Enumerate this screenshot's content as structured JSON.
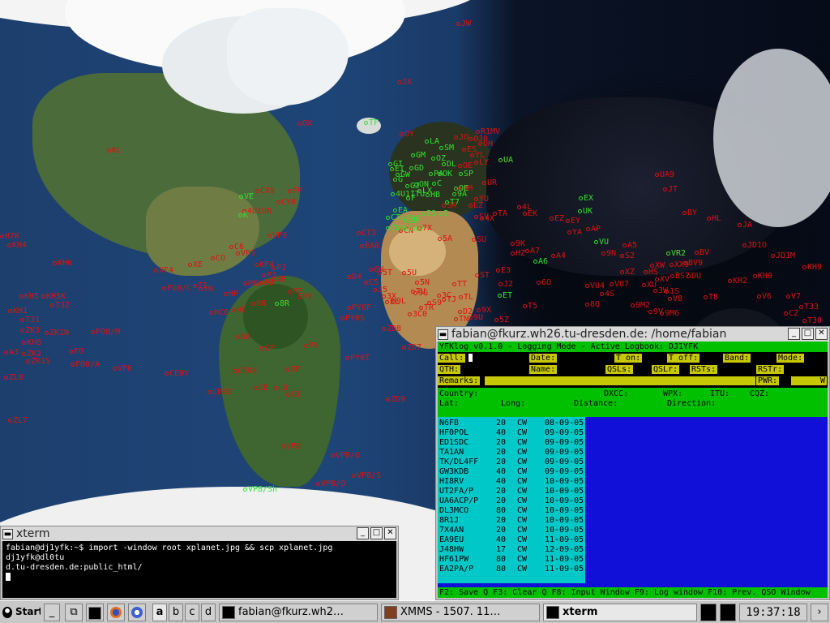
{
  "map": {
    "labels_red": [
      [
        "JW",
        563,
        30
      ],
      [
        "JX",
        490,
        102
      ],
      [
        "OX",
        367,
        153
      ],
      [
        "OY",
        493,
        166
      ],
      [
        "KL",
        132,
        186
      ],
      [
        "R1MV",
        587,
        163
      ],
      [
        "OH",
        590,
        178
      ],
      [
        "JO",
        560,
        170
      ],
      [
        "OJ0",
        578,
        172
      ],
      [
        "ES",
        570,
        185
      ],
      [
        "YL",
        580,
        192
      ],
      [
        "LY",
        585,
        201
      ],
      [
        "UR",
        595,
        226
      ],
      [
        "UA",
        615,
        198
      ],
      [
        "OE",
        565,
        205
      ],
      [
        "OM",
        565,
        233
      ],
      [
        "YU",
        585,
        246
      ],
      [
        "LZ",
        578,
        254
      ],
      [
        "SV",
        585,
        268
      ],
      [
        "TA",
        608,
        264
      ],
      [
        "4L",
        638,
        256
      ],
      [
        "EK",
        645,
        264
      ],
      [
        "EZ",
        678,
        270
      ],
      [
        "EY",
        698,
        273
      ],
      [
        "AP",
        723,
        283
      ],
      [
        "YA",
        700,
        287
      ],
      [
        "9K",
        630,
        301
      ],
      [
        "A4",
        680,
        316
      ],
      [
        "HZ",
        630,
        313
      ],
      [
        "A7",
        648,
        310
      ],
      [
        "4X",
        592,
        270
      ],
      [
        "SU",
        582,
        296
      ],
      [
        "5A",
        540,
        295
      ],
      [
        "7X",
        515,
        282
      ],
      [
        "3A",
        545,
        254
      ],
      [
        "CN",
        492,
        285
      ],
      [
        "CT3",
        440,
        288
      ],
      [
        "EA8",
        444,
        304
      ],
      [
        "CX9",
        315,
        236
      ],
      [
        "FP",
        355,
        236
      ],
      [
        "CY0",
        341,
        250
      ],
      [
        "4U1UN",
        299,
        261
      ],
      [
        "VP9",
        330,
        291
      ],
      [
        "C6",
        283,
        305
      ],
      [
        "XE",
        232,
        327
      ],
      [
        "CO",
        260,
        319
      ],
      [
        "VP5",
        291,
        313
      ],
      [
        "KP4",
        314,
        327
      ],
      [
        "FJ",
        335,
        331
      ],
      [
        "PJ",
        323,
        340
      ],
      [
        "J3",
        320,
        349
      ],
      [
        "8P",
        335,
        345
      ],
      [
        "TI",
        238,
        353
      ],
      [
        "HP",
        276,
        363
      ],
      [
        "YN",
        245,
        357
      ],
      [
        "HK",
        300,
        350
      ],
      [
        "YV",
        318,
        350
      ],
      [
        "8R",
        310,
        375
      ],
      [
        "FY",
        367,
        367
      ],
      [
        "PZ",
        355,
        360
      ],
      [
        "HC8",
        258,
        386
      ],
      [
        "HC",
        286,
        383
      ],
      [
        "OA",
        291,
        416
      ],
      [
        "CP",
        321,
        430
      ],
      [
        "PY",
        375,
        427
      ],
      [
        "PY0F",
        428,
        380
      ],
      [
        "PY0S",
        420,
        393
      ],
      [
        "ZD8",
        471,
        406
      ],
      [
        "ZD7",
        496,
        429
      ],
      [
        "PY0T",
        426,
        442
      ],
      [
        "CE0X",
        287,
        458
      ],
      [
        "CE",
        313,
        479
      ],
      [
        "LU",
        337,
        479
      ],
      [
        "CX",
        353,
        487
      ],
      [
        "ZP",
        352,
        456
      ],
      [
        "CE0Y",
        203,
        461
      ],
      [
        "CE0Z",
        256,
        484
      ],
      [
        "VP8",
        347,
        551
      ],
      [
        "VP8/G",
        408,
        562
      ],
      [
        "VP8/S",
        434,
        587
      ],
      [
        "VP8/O",
        390,
        597
      ],
      [
        "ZD9",
        476,
        493
      ],
      [
        "VP6",
        139,
        455
      ],
      [
        "FO0/A",
        87,
        450
      ],
      [
        "FO",
        85,
        434
      ],
      [
        "FO0/M",
        112,
        410
      ],
      [
        "FO0/C",
        200,
        356
      ],
      [
        "XF4",
        190,
        334
      ],
      [
        "KH4",
        9,
        303
      ],
      [
        "KH6",
        65,
        325
      ],
      [
        "KH5",
        24,
        366
      ],
      [
        "KH5K",
        51,
        366
      ],
      [
        "T32",
        62,
        377
      ],
      [
        "KH1",
        10,
        384
      ],
      [
        "T31",
        25,
        395
      ],
      [
        "ZK3",
        25,
        408
      ],
      [
        "ZK1N",
        55,
        411
      ],
      [
        "KH8",
        27,
        423
      ],
      [
        "ZK2",
        27,
        437
      ],
      [
        "ZK1S",
        32,
        446
      ],
      [
        "A3",
        5,
        435
      ],
      [
        "ZL8",
        5,
        466
      ],
      [
        "ZL7",
        10,
        519
      ],
      [
        "H7K",
        0,
        292
      ],
      [
        "6W",
        455,
        333
      ],
      [
        "D4",
        428,
        342
      ],
      [
        "C5",
        449,
        349
      ],
      [
        "5U",
        496,
        337
      ],
      [
        "5T",
        466,
        337
      ],
      [
        "J5",
        460,
        358
      ],
      [
        "3X",
        471,
        366
      ],
      [
        "9L",
        483,
        372
      ],
      [
        "EL",
        475,
        373
      ],
      [
        "TU",
        507,
        360
      ],
      [
        "9G",
        510,
        362
      ],
      [
        "5N",
        512,
        349
      ],
      [
        "TT",
        558,
        351
      ],
      [
        "ST",
        586,
        340
      ],
      [
        "E3",
        612,
        334
      ],
      [
        "J2",
        615,
        351
      ],
      [
        "T5",
        645,
        378
      ],
      [
        "6O",
        662,
        349
      ],
      [
        "5Z",
        610,
        395
      ],
      [
        "9X",
        588,
        383
      ],
      [
        "TJ",
        545,
        370
      ],
      [
        "TL",
        566,
        367
      ],
      [
        "TN",
        560,
        394
      ],
      [
        "9U",
        578,
        392
      ],
      [
        "3C0",
        503,
        388
      ],
      [
        "TR",
        517,
        380
      ],
      [
        "S9",
        527,
        374
      ],
      [
        "3C",
        539,
        365
      ],
      [
        "D2",
        565,
        385
      ],
      [
        "ZS",
        563,
        408
      ],
      [
        "4S",
        740,
        363
      ],
      [
        "VU4",
        722,
        353
      ],
      [
        "VU7",
        752,
        351
      ],
      [
        "8Q",
        722,
        376
      ],
      [
        "9M2",
        778,
        377
      ],
      [
        "XU",
        792,
        352
      ],
      [
        "XV",
        808,
        345
      ],
      [
        "3W",
        806,
        359
      ],
      [
        "1S",
        820,
        360
      ],
      [
        "V8",
        824,
        369
      ],
      [
        "9V",
        800,
        385
      ],
      [
        "9M6",
        814,
        387
      ],
      [
        "BS7",
        827,
        341
      ],
      [
        "DU",
        847,
        341
      ],
      [
        "KH2",
        898,
        347
      ],
      [
        "KH0",
        929,
        341
      ],
      [
        "T8",
        868,
        367
      ],
      [
        "V6",
        934,
        366
      ],
      [
        "V7",
        970,
        366
      ],
      [
        "T33",
        986,
        379
      ],
      [
        "C2",
        967,
        387
      ],
      [
        "T30",
        990,
        396
      ],
      [
        "KH9",
        990,
        330
      ],
      [
        "JD1M",
        951,
        316
      ],
      [
        "JD1O",
        916,
        303
      ],
      [
        "JA",
        910,
        278
      ],
      [
        "HL",
        872,
        270
      ],
      [
        "BV",
        857,
        312
      ],
      [
        "BV9",
        843,
        325
      ],
      [
        "XX9",
        826,
        327
      ],
      [
        "XW",
        802,
        328
      ],
      [
        "XZ",
        765,
        336
      ],
      [
        "HS",
        794,
        336
      ],
      [
        "S2",
        765,
        316
      ],
      [
        "A5",
        768,
        303
      ],
      [
        "9N",
        742,
        313
      ],
      [
        "UA9",
        808,
        216
      ],
      [
        "JT",
        818,
        234
      ],
      [
        "BY",
        842,
        263
      ],
      [
        "VR2",
        822,
        313
      ]
    ],
    "labels_green": [
      [
        "TF",
        449,
        152
      ],
      [
        "LA",
        524,
        175
      ],
      [
        "SM",
        542,
        183
      ],
      [
        "OZ",
        532,
        196
      ],
      [
        "GM",
        507,
        192
      ],
      [
        "GI",
        479,
        203
      ],
      [
        "EI",
        481,
        209
      ],
      [
        "GD",
        505,
        208
      ],
      [
        "GW",
        488,
        216
      ],
      [
        "G",
        485,
        222
      ],
      [
        "PA",
        529,
        215
      ],
      [
        "DL",
        545,
        203
      ],
      [
        "SP",
        566,
        215
      ],
      [
        "OK",
        540,
        215
      ],
      [
        "GJ",
        500,
        230
      ],
      [
        "ON",
        511,
        228
      ],
      [
        "LX",
        515,
        236
      ],
      [
        "F",
        501,
        245
      ],
      [
        "HB",
        525,
        241
      ],
      [
        "OE",
        560,
        233
      ],
      [
        "4U1ITU",
        482,
        240
      ],
      [
        "EA",
        485,
        260
      ],
      [
        "CT",
        476,
        269
      ],
      [
        "EA6",
        495,
        270
      ],
      [
        "ZB",
        498,
        273
      ],
      [
        "CN8",
        476,
        282
      ],
      [
        "IS",
        520,
        264
      ],
      [
        "I",
        541,
        264
      ],
      [
        "T7",
        549,
        250
      ],
      [
        "9A",
        558,
        240
      ],
      [
        "UK",
        713,
        261
      ],
      [
        "EX",
        714,
        245
      ],
      [
        "VR2",
        822,
        313
      ],
      [
        "A6",
        658,
        323
      ],
      [
        "VU",
        733,
        299
      ],
      [
        "VE",
        295,
        243
      ],
      [
        "K",
        294,
        266
      ],
      [
        "VP8/Sh",
        300,
        604
      ],
      [
        "UA",
        615,
        198
      ],
      [
        "ET",
        614,
        365
      ],
      [
        "8R",
        339,
        375
      ],
      [
        "EA9",
        498,
        283
      ],
      [
        "C",
        533,
        227
      ]
    ]
  },
  "xterm": {
    "title": "xterm",
    "line1": "fabian@dj1yfk:~$ import -window root xplanet.jpg && scp xplanet.jpg dj1yfk@dl0tu",
    "line2": "d.tu-dresden.de:public_html/"
  },
  "yfklog": {
    "title": "fabian@fkurz.wh26.tu-dresden.de: /home/fabian",
    "header": "YFKlog v0.1.0 - Logging Mode - Active Logbook: DJ1YFK",
    "fields": {
      "call": "Call:",
      "date": "Date:",
      "t_on": "T on:",
      "t_off": "T off:",
      "band": "Band:",
      "mode": "Mode:",
      "qth": "QTH:",
      "name": "Name:",
      "qsls": "QSLs:",
      "qslr": "QSLr:",
      "rsts": "RSTs:",
      "rstr": "RSTr:",
      "remarks": "Remarks:",
      "pwr": "PWR:",
      "pwr_unit": "W"
    },
    "info": {
      "country": "Country:",
      "dxcc": "DXCC:",
      "wpx": "WPX:",
      "itu": "ITU:",
      "cqz": "CQZ:",
      "lat": "Lat:",
      "long": "Long:",
      "distance": "Distance:",
      "direction": "Direction:"
    },
    "log_rows": [
      [
        "N6FB",
        "20",
        "CW",
        "08-09-05"
      ],
      [
        "HF0POL",
        "40",
        "CW",
        "09-09-05"
      ],
      [
        "ED1SDC",
        "20",
        "CW",
        "09-09-05"
      ],
      [
        "TA1AN",
        "20",
        "CW",
        "09-09-05"
      ],
      [
        "TK/DL4FF",
        "20",
        "CW",
        "09-09-05"
      ],
      [
        "GW3KDB",
        "40",
        "CW",
        "09-09-05"
      ],
      [
        "HI8RV",
        "40",
        "CW",
        "10-09-05"
      ],
      [
        "UT2FA/P",
        "20",
        "CW",
        "10-09-05"
      ],
      [
        "UA6ACP/P",
        "20",
        "CW",
        "10-09-05"
      ],
      [
        "DL3MCO",
        "80",
        "CW",
        "10-09-05"
      ],
      [
        "8R1J",
        "20",
        "CW",
        "10-09-05"
      ],
      [
        "7X4AN",
        "20",
        "CW",
        "10-09-05"
      ],
      [
        "EA9EU",
        "40",
        "CW",
        "11-09-05"
      ],
      [
        "J48HW",
        "17",
        "CW",
        "12-09-05"
      ],
      [
        "HF61PW",
        "80",
        "CW",
        "11-09-05"
      ],
      [
        "EA2PA/P",
        "80",
        "CW",
        "11-09-05"
      ]
    ],
    "footer": "F2: Save Q   F3: Clear Q   F8: Input Window   F9: Log window   F10: Prev. QSO Window"
  },
  "taskbar": {
    "start": "Start",
    "desktops": [
      "a",
      "b",
      "c",
      "d"
    ],
    "tasks": [
      {
        "label": "fabian@fkurz.wh2…",
        "icon": "terminal-icon"
      },
      {
        "label": "XMMS - 1507. 11…",
        "icon": "xmms-icon"
      },
      {
        "label": "xterm",
        "icon": "terminal-icon"
      }
    ],
    "clock": "19:37:18"
  },
  "colors": {
    "label_red": "#e01010",
    "label_green": "#30e030",
    "yfk_green": "#00c000",
    "yfk_cyan": "#00c8c8",
    "yfk_blue": "#1010d8",
    "field_yellow": "#c8c800"
  }
}
